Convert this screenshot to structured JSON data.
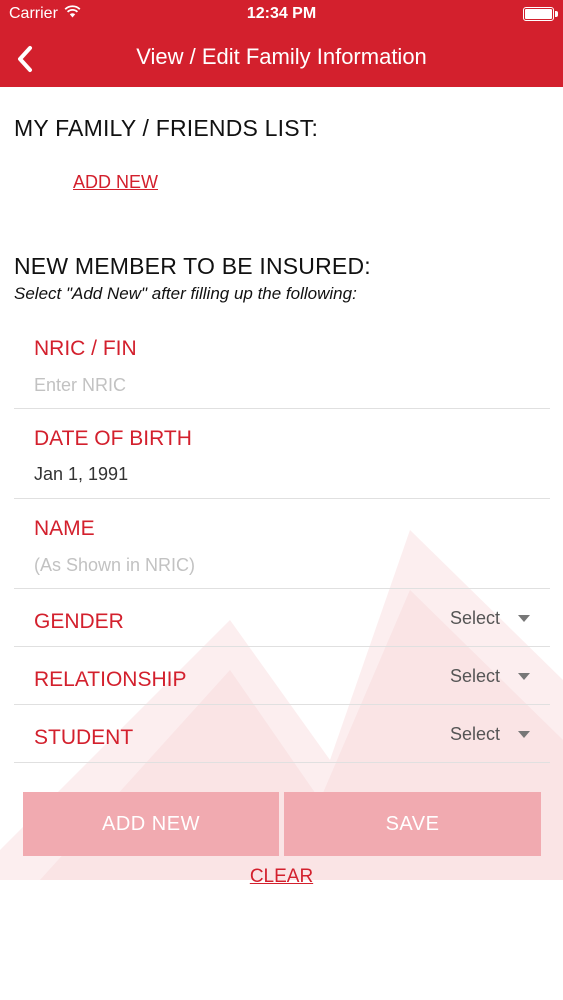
{
  "status_bar": {
    "carrier": "Carrier",
    "time": "12:34 PM"
  },
  "nav": {
    "title": "View / Edit Family Information"
  },
  "family_list": {
    "title": "MY FAMILY / FRIENDS LIST:",
    "add_new_link": "ADD NEW"
  },
  "new_member": {
    "title": "NEW MEMBER TO BE INSURED:",
    "instruction": "Select \"Add New\" after filling up the following:"
  },
  "form": {
    "nric": {
      "label": "NRIC / FIN",
      "placeholder": "Enter NRIC",
      "value": ""
    },
    "dob": {
      "label": "DATE OF BIRTH",
      "value": "Jan 1, 1991"
    },
    "name": {
      "label": "NAME",
      "placeholder": "(As Shown in NRIC)",
      "value": ""
    },
    "gender": {
      "label": "GENDER",
      "value": "Select"
    },
    "relationship": {
      "label": "RELATIONSHIP",
      "value": "Select"
    },
    "student": {
      "label": "STUDENT",
      "value": "Select"
    }
  },
  "buttons": {
    "add_new": "ADD NEW",
    "save": "SAVE",
    "clear": "CLEAR"
  },
  "colors": {
    "brand_red": "#d3202d",
    "button_disabled": "#f1aab0"
  },
  "icons": {
    "back": "chevron-left-icon",
    "wifi": "wifi-icon",
    "battery": "battery-icon",
    "dropdown": "caret-down-icon"
  }
}
